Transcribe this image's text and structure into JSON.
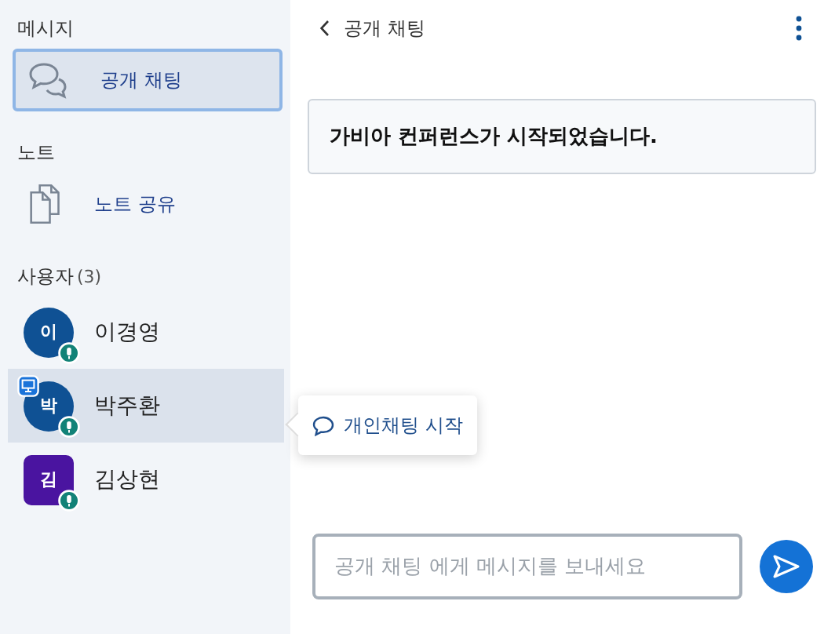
{
  "sidebar": {
    "sections": [
      {
        "heading": "메시지",
        "items": [
          {
            "label": "공개 채팅",
            "kind": "chat",
            "selected": true
          }
        ]
      },
      {
        "heading": "노트",
        "items": [
          {
            "label": "노트 공유",
            "kind": "notes",
            "selected": false
          }
        ]
      }
    ],
    "users": {
      "heading": "사용자",
      "count": "(3)",
      "items": [
        {
          "initial": "이",
          "name": "이경영",
          "color": "#0f5194",
          "kind": "circle",
          "presenter": false,
          "selected": false
        },
        {
          "initial": "박",
          "name": "박주환",
          "color": "#0f5194",
          "kind": "circle",
          "presenter": true,
          "selected": true
        },
        {
          "initial": "김",
          "name": "김상현",
          "color": "#4a14a0",
          "kind": "square",
          "presenter": false,
          "selected": false
        }
      ]
    }
  },
  "tooltip": {
    "label": "개인채팅 시작"
  },
  "chat": {
    "title": "공개 채팅",
    "messages": [
      "가비아 컨퍼런스가 시작되었습니다."
    ],
    "input": {
      "placeholder": "공개 채팅 에게 메시지를 보내세요"
    }
  }
}
